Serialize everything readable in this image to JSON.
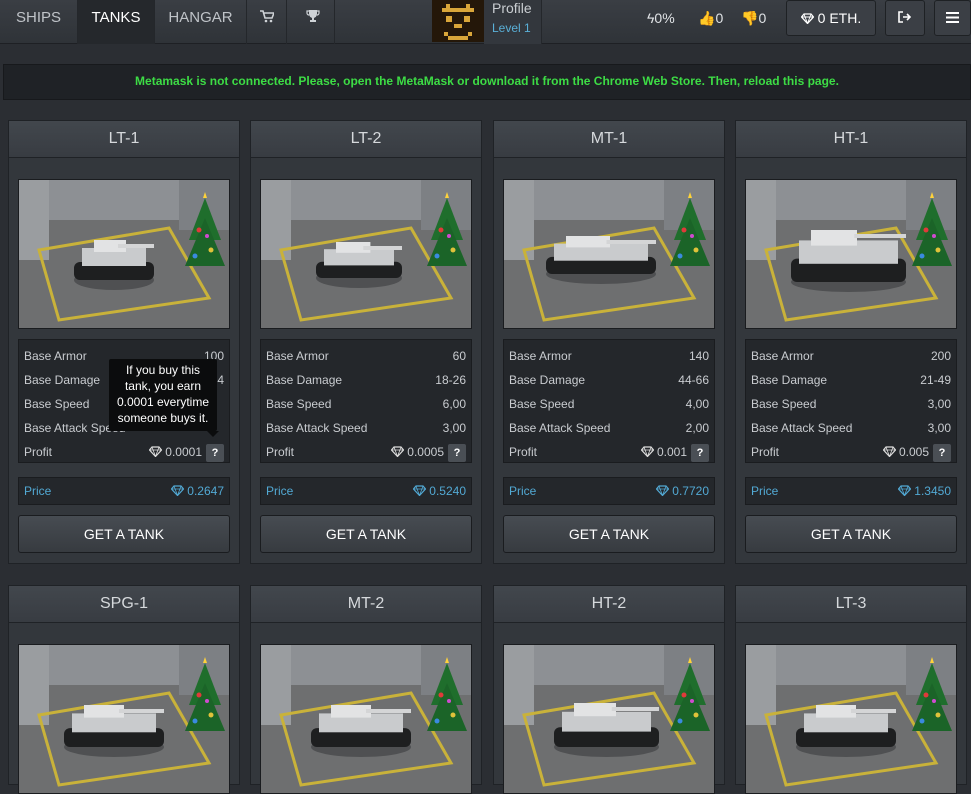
{
  "nav": {
    "tabs": [
      {
        "label": "SHIPS",
        "active": false
      },
      {
        "label": "TANKS",
        "active": true
      },
      {
        "label": "HANGAR",
        "active": false
      }
    ],
    "icons": [
      "cart-icon",
      "trophy-icon"
    ],
    "profile": {
      "name": "Profile",
      "level": "Level 1"
    },
    "stats": {
      "power": "0%",
      "likes": "0",
      "dislikes": "0"
    },
    "eth_label": "0 ETH.",
    "logout_icon": "logout-icon",
    "menu_icon": "menu-icon"
  },
  "alert": "Metamask is not connected. Please, open the MetaMask or download it from the Chrome Web Store. Then, reload this page.",
  "labels": {
    "armor": "Base Armor",
    "damage": "Base Damage",
    "speed": "Base Speed",
    "attack_speed": "Base Attack Speed",
    "profit": "Profit",
    "price": "Price",
    "buy": "GET A TANK"
  },
  "tooltip": "If you buy this tank, you earn 0.0001 everytime someone buys it.",
  "tanks": [
    {
      "name": "LT-1",
      "armor": "100",
      "damage": "14",
      "speed": "",
      "attack_speed": "",
      "profit": "0.0001",
      "price": "0.2647"
    },
    {
      "name": "LT-2",
      "armor": "60",
      "damage": "18-26",
      "speed": "6,00",
      "attack_speed": "3,00",
      "profit": "0.0005",
      "price": "0.5240"
    },
    {
      "name": "MT-1",
      "armor": "140",
      "damage": "44-66",
      "speed": "4,00",
      "attack_speed": "2,00",
      "profit": "0.001",
      "price": "0.7720"
    },
    {
      "name": "HT-1",
      "armor": "200",
      "damage": "21-49",
      "speed": "3,00",
      "attack_speed": "3,00",
      "profit": "0.005",
      "price": "1.3450"
    },
    {
      "name": "SPG-1"
    },
    {
      "name": "MT-2"
    },
    {
      "name": "HT-2"
    },
    {
      "name": "LT-3"
    }
  ],
  "colors": {
    "accent": "#52a9d4",
    "alert": "#3ddc45",
    "panel": "#33373c",
    "background": "#2b2e33"
  }
}
